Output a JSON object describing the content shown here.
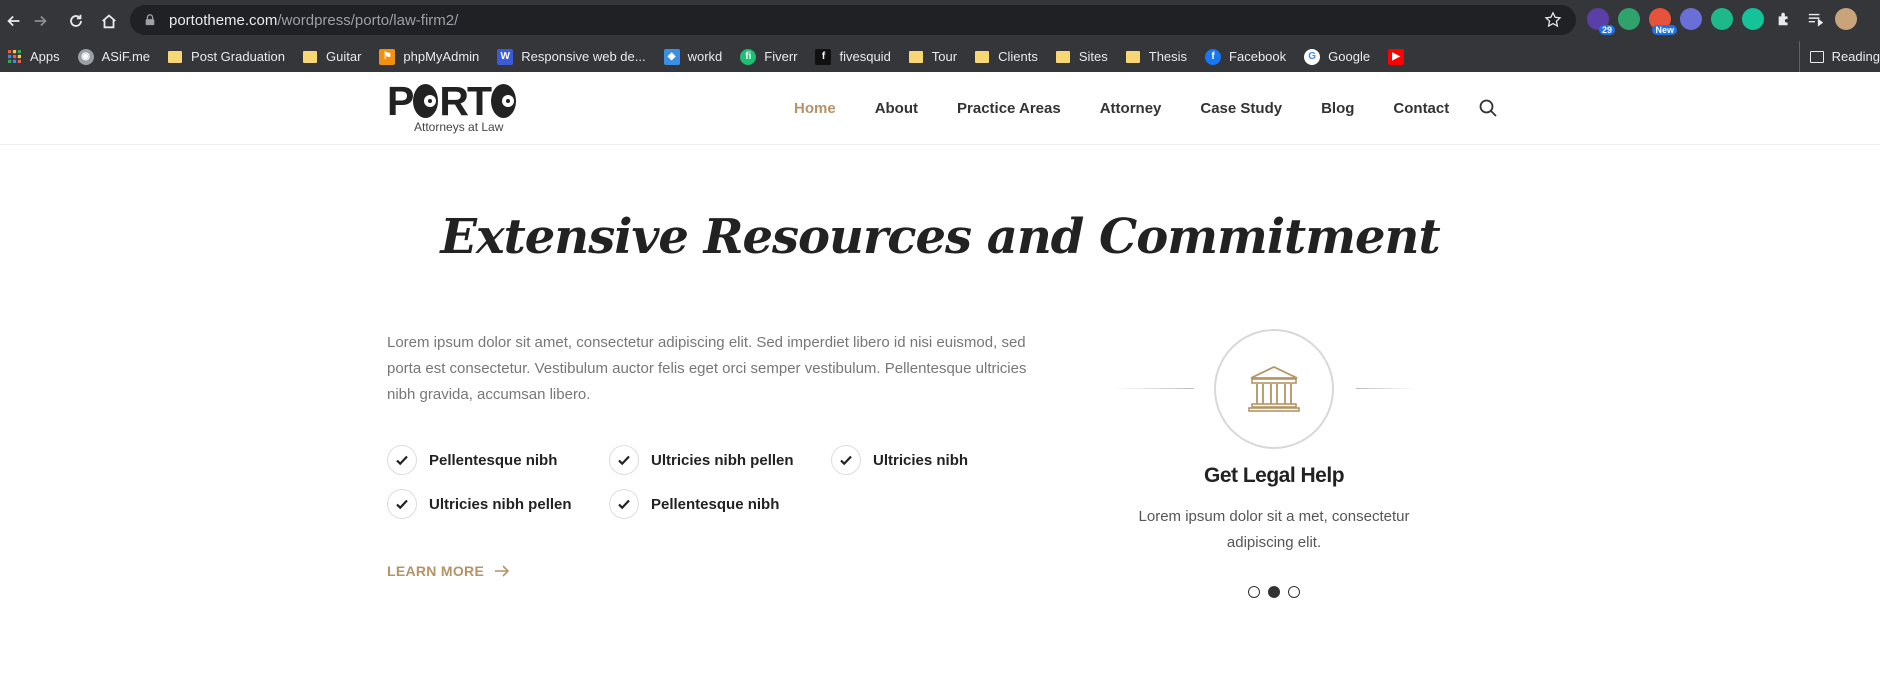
{
  "browser": {
    "url_host": "portotheme.com",
    "url_path": "/wordpress/porto/law-firm2/",
    "extensions": [
      {
        "icon": "graduation-cap-extension-icon",
        "badge": "29",
        "color": "#5b3fa8"
      },
      {
        "icon": "green-extension-icon",
        "badge": "",
        "color": "#2fa36b"
      },
      {
        "icon": "rainbow-extension-icon",
        "badge": "New",
        "color": "#e5533c"
      },
      {
        "icon": "eyedropper-extension-icon",
        "badge": "",
        "color": "#6a6fd8"
      },
      {
        "icon": "leaf-extension-icon",
        "badge": "",
        "color": "#1db98b"
      },
      {
        "icon": "grammarly-extension-icon",
        "badge": "",
        "color": "#15c39a"
      },
      {
        "icon": "puzzle-icon",
        "badge": "",
        "color": "#e8eaed"
      },
      {
        "icon": "media-queue-icon",
        "badge": "",
        "color": "#e8eaed"
      },
      {
        "icon": "profile-avatar",
        "badge": "",
        "color": "#c9a37a"
      }
    ],
    "bookmarks": [
      {
        "label": "Apps",
        "icon": "apps-grid-icon"
      },
      {
        "label": "ASiF.me",
        "icon": "globe-icon"
      },
      {
        "label": "Post Graduation",
        "icon": "folder-icon"
      },
      {
        "label": "Guitar",
        "icon": "folder-icon"
      },
      {
        "label": "phpMyAdmin",
        "icon": "phpmyadmin-icon"
      },
      {
        "label": "Responsive web de...",
        "icon": "w-icon"
      },
      {
        "label": "workd",
        "icon": "workd-icon"
      },
      {
        "label": "Fiverr",
        "icon": "fiverr-icon"
      },
      {
        "label": "fivesquid",
        "icon": "fivesquid-icon"
      },
      {
        "label": "Tour",
        "icon": "folder-icon"
      },
      {
        "label": "Clients",
        "icon": "folder-icon"
      },
      {
        "label": "Sites",
        "icon": "folder-icon"
      },
      {
        "label": "Thesis",
        "icon": "folder-icon"
      },
      {
        "label": "Facebook",
        "icon": "facebook-icon"
      },
      {
        "label": "Google",
        "icon": "google-icon"
      },
      {
        "label": "",
        "icon": "youtube-icon"
      }
    ],
    "reading_list": "Reading"
  },
  "site": {
    "logo_word": "PORTO",
    "logo_tagline": "Attorneys at Law",
    "nav": [
      "Home",
      "About",
      "Practice Areas",
      "Attorney",
      "Case Study",
      "Blog",
      "Contact"
    ],
    "active_nav": "Home",
    "accent_color": "#b49467"
  },
  "main": {
    "headline": "Extensive Resources and Commitment",
    "intro": "Lorem ipsum dolor sit amet, consectetur adipiscing elit. Sed imperdiet libero id nisi euismod, sed porta est consectetur. Vestibulum auctor felis eget orci semper vestibulum. Pellentesque ultricies nibh gravida, accumsan libero.",
    "features": [
      "Pellentesque nibh",
      "Ultricies nibh pellen",
      "Ultricies nibh",
      "Ultricies nibh pellen",
      "Pellentesque nibh"
    ],
    "learn_more": "LEARN MORE"
  },
  "carousel": {
    "icon": "courthouse-icon",
    "title": "Get Legal Help",
    "text": "Lorem ipsum dolor sit a met, consectetur adipiscing elit.",
    "dots": 3,
    "active_dot": 2
  }
}
